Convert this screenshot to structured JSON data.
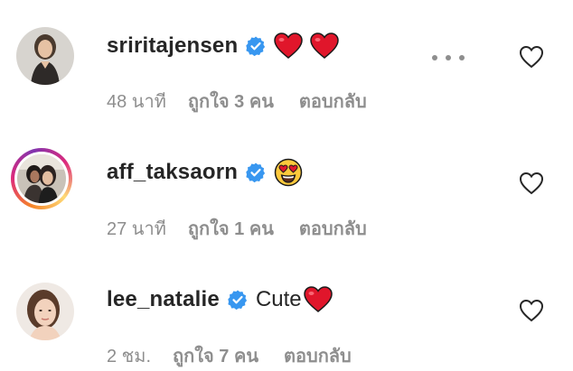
{
  "comments": [
    {
      "username": "sriritajensen",
      "text": "",
      "emojis": [
        "red-heart",
        "red-heart"
      ],
      "time": "48 นาที",
      "likes": "ถูกใจ 3 คน",
      "reply": "ตอบกลับ",
      "story_ring": false
    },
    {
      "username": "aff_taksaorn",
      "text": "",
      "emojis": [
        "heart-eyes"
      ],
      "time": "27 นาที",
      "likes": "ถูกใจ 1 คน",
      "reply": "ตอบกลับ",
      "story_ring": true
    },
    {
      "username": "lee_natalie",
      "text": "Cute",
      "emojis": [
        "red-heart"
      ],
      "time": "2 ชม.",
      "likes": "ถูกใจ 7 คน",
      "reply": "ตอบกลับ",
      "story_ring": false
    }
  ],
  "icons": {
    "verified": "verified-badge-icon",
    "like": "heart-outline-icon",
    "more": "more-options-icon"
  },
  "colors": {
    "verified_blue": "#3897f0",
    "meta_gray": "#8e8e8e",
    "text": "#262626",
    "emoji_red": "#e0162b"
  }
}
